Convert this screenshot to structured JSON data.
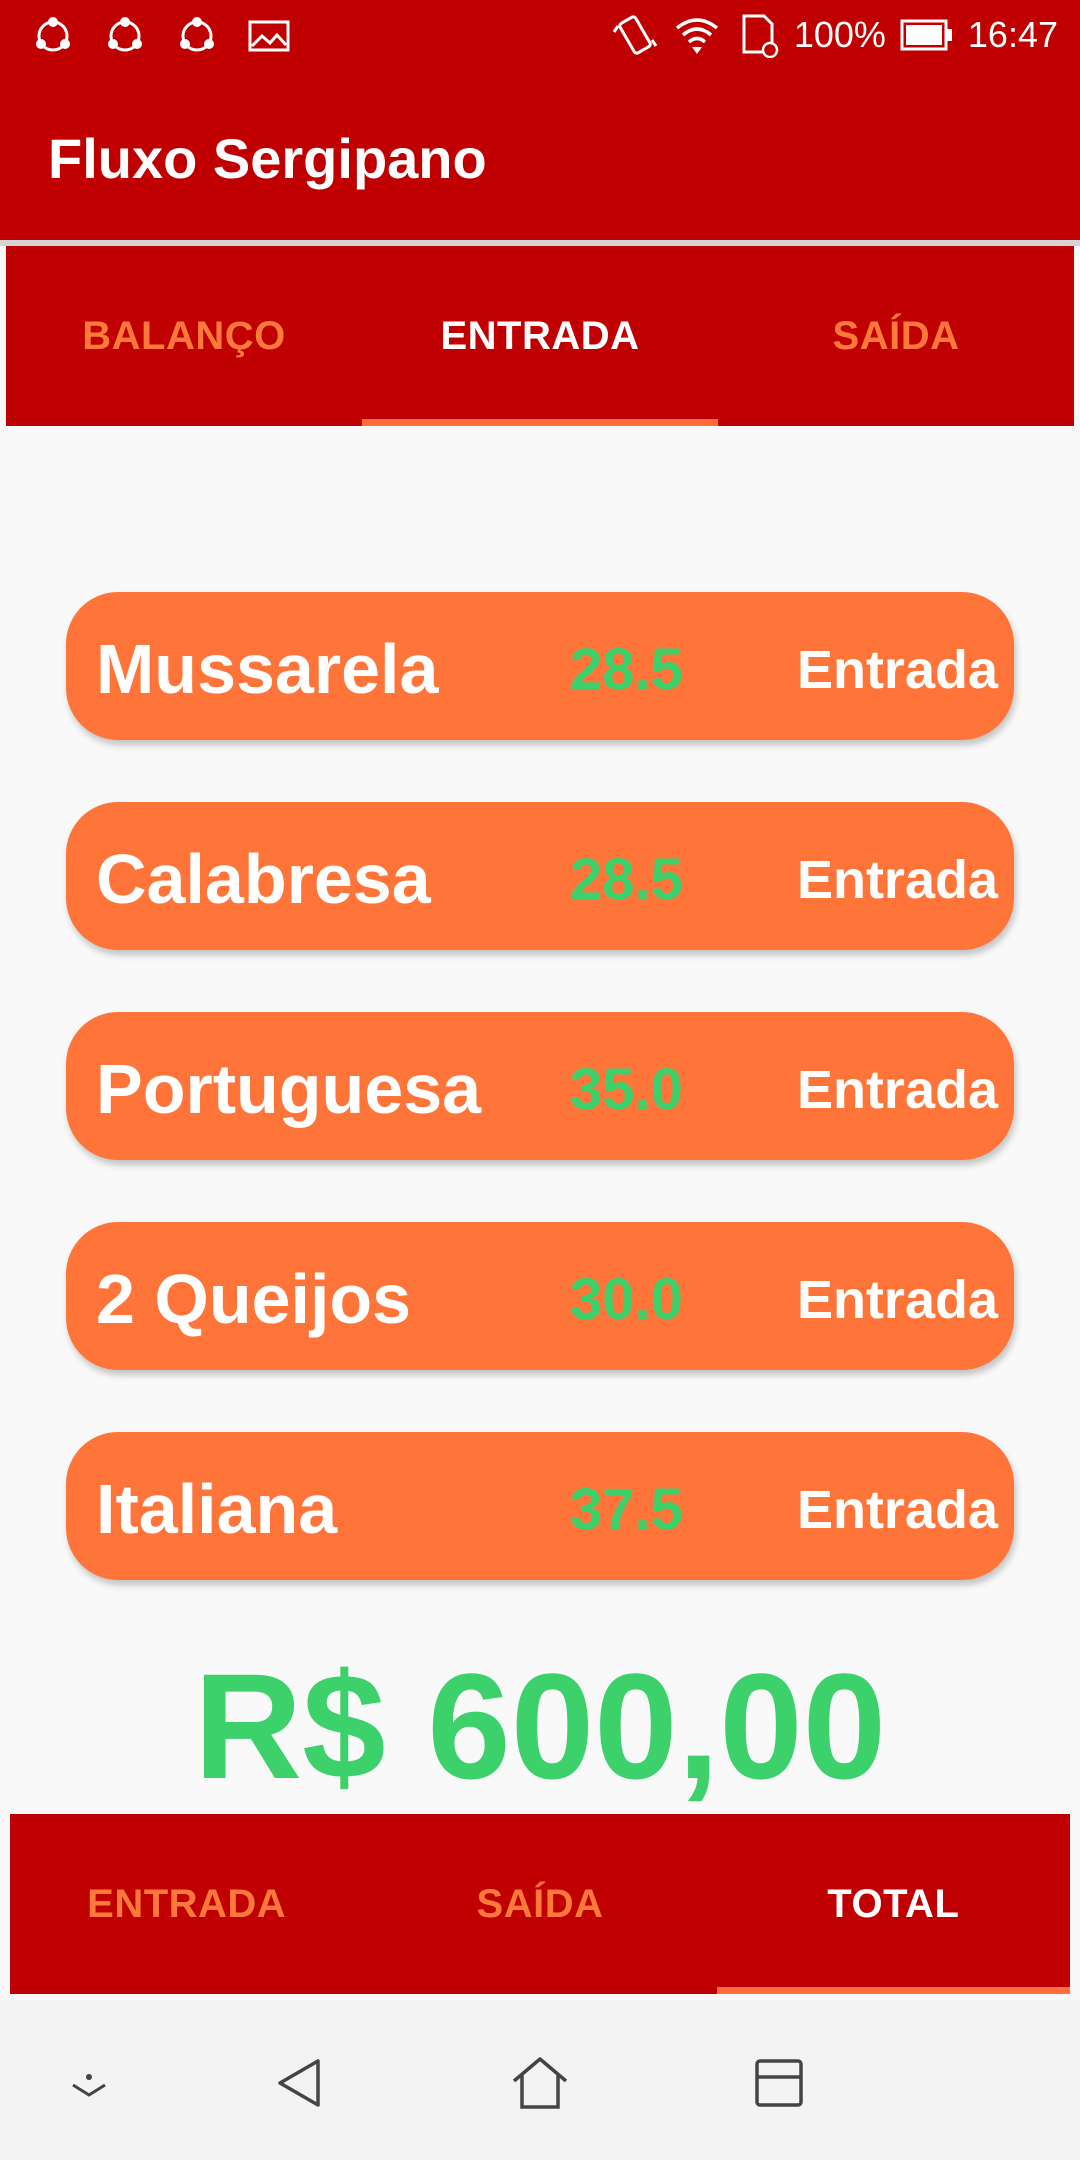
{
  "status_bar": {
    "left_icons": [
      "share-icon",
      "share-icon",
      "share-icon",
      "image-icon"
    ],
    "right_icons": [
      "vibrate-icon",
      "wifi-icon",
      "sd-card-icon",
      "battery-icon"
    ],
    "battery": "100%",
    "time": "16:47"
  },
  "app": {
    "title": "Fluxo Sergipano",
    "colors": {
      "primary": "#c00000",
      "accent": "#ff7539",
      "value_green": "#3dd16b"
    }
  },
  "top_tabs": [
    {
      "label": "BALANÇO",
      "active": false
    },
    {
      "label": "ENTRADA",
      "active": true
    },
    {
      "label": "SAÍDA",
      "active": false
    }
  ],
  "items": [
    {
      "name": "Mussarela",
      "value": "28.5",
      "type": "Entrada"
    },
    {
      "name": "Calabresa",
      "value": "28.5",
      "type": "Entrada"
    },
    {
      "name": "Portuguesa",
      "value": "35.0",
      "type": "Entrada"
    },
    {
      "name": "2 Queijos",
      "value": "30.0",
      "type": "Entrada"
    },
    {
      "name": "Italiana",
      "value": "37.5",
      "type": "Entrada"
    }
  ],
  "total": "R$ 600,00",
  "bottom_tabs": [
    {
      "label": "ENTRADA",
      "active": false
    },
    {
      "label": "SAÍDA",
      "active": false
    },
    {
      "label": "TOTAL",
      "active": true
    }
  ],
  "nav_icons": [
    "collapse-icon",
    "back-icon",
    "home-icon",
    "recents-icon"
  ]
}
